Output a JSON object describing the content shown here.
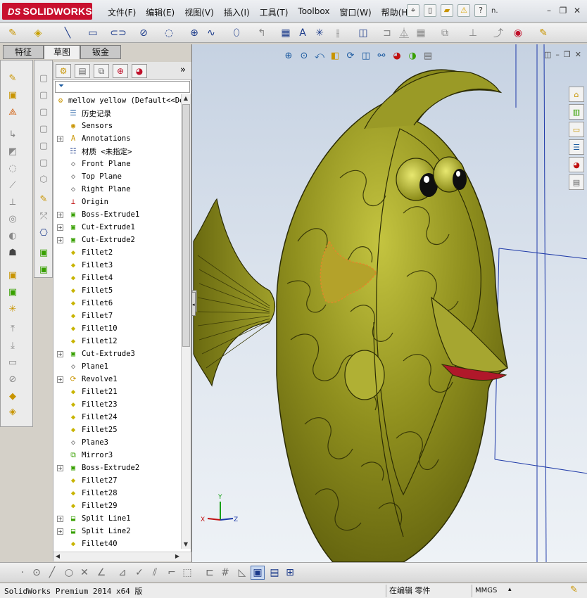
{
  "app": {
    "brand": "SOLIDWORKS",
    "brand_prefix": "DS"
  },
  "menu": [
    "文件(F)",
    "编辑(E)",
    "视图(V)",
    "插入(I)",
    "工具(T)",
    "Toolbox",
    "窗口(W)",
    "帮助(H)"
  ],
  "title_tools": {
    "extra_label": "?",
    "trunc": "n."
  },
  "tabs": [
    {
      "label": "特征",
      "active": false
    },
    {
      "label": "草图",
      "active": true
    },
    {
      "label": "钣金",
      "active": false
    }
  ],
  "feature_tree": {
    "root": "mellow yellow  (Default<<De",
    "items": [
      {
        "label": "历史记录",
        "icon": "history-icon",
        "expandable": false
      },
      {
        "label": "Sensors",
        "icon": "sensor-icon",
        "expandable": false
      },
      {
        "label": "Annotations",
        "icon": "annotation-icon",
        "expandable": true
      },
      {
        "label": "材质 <未指定>",
        "icon": "material-icon",
        "expandable": false
      },
      {
        "label": "Front Plane",
        "icon": "plane-icon",
        "expandable": false
      },
      {
        "label": "Top Plane",
        "icon": "plane-icon",
        "expandable": false
      },
      {
        "label": "Right Plane",
        "icon": "plane-icon",
        "expandable": false
      },
      {
        "label": "Origin",
        "icon": "origin-icon",
        "expandable": false
      },
      {
        "label": "Boss-Extrude1",
        "icon": "extrude-icon",
        "expandable": true
      },
      {
        "label": "Cut-Extrude1",
        "icon": "cut-extrude-icon",
        "expandable": true
      },
      {
        "label": "Cut-Extrude2",
        "icon": "cut-extrude-icon",
        "expandable": true
      },
      {
        "label": "Fillet2",
        "icon": "fillet-icon",
        "expandable": false
      },
      {
        "label": "Fillet3",
        "icon": "fillet-icon",
        "expandable": false
      },
      {
        "label": "Fillet4",
        "icon": "fillet-icon",
        "expandable": false
      },
      {
        "label": "Fillet5",
        "icon": "fillet-icon",
        "expandable": false
      },
      {
        "label": "Fillet6",
        "icon": "fillet-icon",
        "expandable": false
      },
      {
        "label": "Fillet7",
        "icon": "fillet-icon",
        "expandable": false
      },
      {
        "label": "Fillet10",
        "icon": "fillet-icon",
        "expandable": false
      },
      {
        "label": "Fillet12",
        "icon": "fillet-icon",
        "expandable": false
      },
      {
        "label": "Cut-Extrude3",
        "icon": "cut-extrude-icon",
        "expandable": true
      },
      {
        "label": "Plane1",
        "icon": "plane-icon",
        "expandable": false
      },
      {
        "label": "Revolve1",
        "icon": "revolve-icon",
        "expandable": true
      },
      {
        "label": "Fillet21",
        "icon": "fillet-icon",
        "expandable": false
      },
      {
        "label": "Fillet23",
        "icon": "fillet-icon",
        "expandable": false
      },
      {
        "label": "Fillet24",
        "icon": "fillet-icon",
        "expandable": false
      },
      {
        "label": "Fillet25",
        "icon": "fillet-icon",
        "expandable": false
      },
      {
        "label": "Plane3",
        "icon": "plane-icon",
        "expandable": false
      },
      {
        "label": "Mirror3",
        "icon": "mirror-icon",
        "expandable": false
      },
      {
        "label": "Boss-Extrude2",
        "icon": "extrude-icon",
        "expandable": true
      },
      {
        "label": "Fillet27",
        "icon": "fillet-icon",
        "expandable": false
      },
      {
        "label": "Fillet28",
        "icon": "fillet-icon",
        "expandable": false
      },
      {
        "label": "Fillet29",
        "icon": "fillet-icon",
        "expandable": false
      },
      {
        "label": "Split Line1",
        "icon": "split-line-icon",
        "expandable": true
      },
      {
        "label": "Split Line2",
        "icon": "split-line-icon",
        "expandable": true
      },
      {
        "label": "Fillet40",
        "icon": "fillet-icon",
        "expandable": false
      }
    ]
  },
  "triad": {
    "x": "X",
    "y": "Y",
    "z": "Z"
  },
  "status": {
    "product": "SolidWorks Premium 2014 x64 版",
    "mode": "在编辑 零件",
    "units": "MMGS"
  },
  "colors": {
    "model_body": "#8a8a1c",
    "model_highlight": "#c8c84a",
    "lip": "#b0182a",
    "selection": "#e08a2a",
    "viewport_top": "#c6d2e2",
    "viewport_bottom": "#eef2f6",
    "brand": "#c8102e"
  }
}
